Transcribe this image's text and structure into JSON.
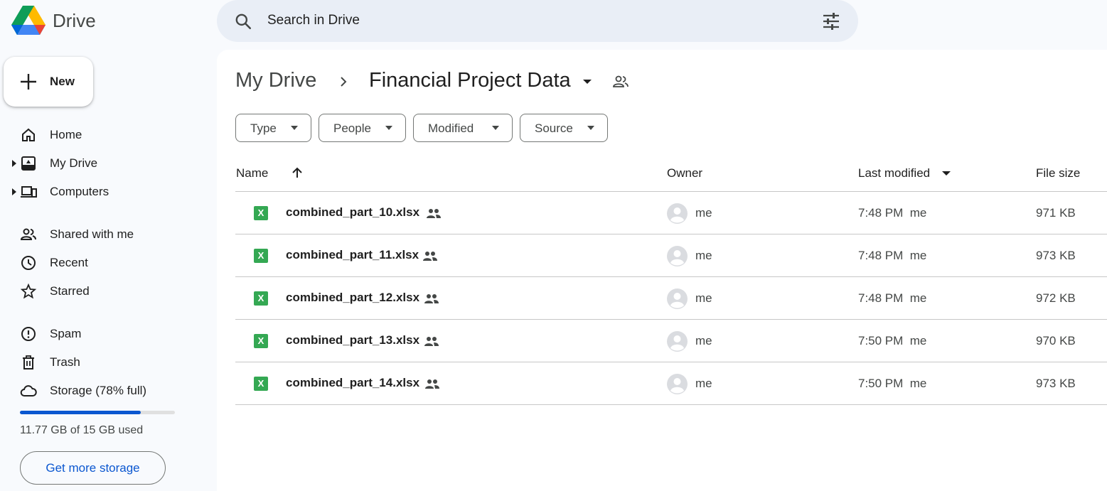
{
  "app": {
    "title": "Drive",
    "logo_icon": "google-drive-logo-icon"
  },
  "search": {
    "placeholder": "Search in Drive",
    "search_icon": "search-icon",
    "filter_icon": "tune-icon"
  },
  "sidebar": {
    "new_label": "New",
    "items": [
      {
        "label": "Home",
        "icon": "home-icon"
      },
      {
        "label": "My Drive",
        "icon": "my-drive-icon"
      },
      {
        "label": "Computers",
        "icon": "computers-icon"
      },
      {
        "label": "Shared with me",
        "icon": "people-icon"
      },
      {
        "label": "Recent",
        "icon": "clock-icon"
      },
      {
        "label": "Starred",
        "icon": "star-icon"
      },
      {
        "label": "Spam",
        "icon": "spam-icon"
      },
      {
        "label": "Trash",
        "icon": "trash-icon"
      },
      {
        "label": "Storage (78% full)",
        "icon": "cloud-icon"
      }
    ],
    "storage": {
      "used_fraction": 0.78,
      "text": "11.77 GB of 15 GB used",
      "button_label": "Get more storage",
      "bar_color": "#0b57d0"
    }
  },
  "breadcrumb": {
    "root": "My Drive",
    "current": "Financial Project Data"
  },
  "filters": [
    {
      "label": "Type"
    },
    {
      "label": "People"
    },
    {
      "label": "Modified"
    },
    {
      "label": "Source"
    }
  ],
  "table": {
    "columns": {
      "name": "Name",
      "owner": "Owner",
      "modified": "Last modified",
      "size": "File size"
    },
    "rows": [
      {
        "name": "combined_part_10.xlsx",
        "owner": "me",
        "modified": "7:48 PM  me",
        "size": "971 KB"
      },
      {
        "name": "combined_part_11.xlsx",
        "owner": "me",
        "modified": "7:48 PM  me",
        "size": "973 KB"
      },
      {
        "name": "combined_part_12.xlsx",
        "owner": "me",
        "modified": "7:48 PM  me",
        "size": "972 KB"
      },
      {
        "name": "combined_part_13.xlsx",
        "owner": "me",
        "modified": "7:50 PM  me",
        "size": "970 KB"
      },
      {
        "name": "combined_part_14.xlsx",
        "owner": "me",
        "modified": "7:50 PM  me",
        "size": "973 KB"
      }
    ],
    "file_icon_letter": "X",
    "file_icon_color": "#34a853"
  }
}
